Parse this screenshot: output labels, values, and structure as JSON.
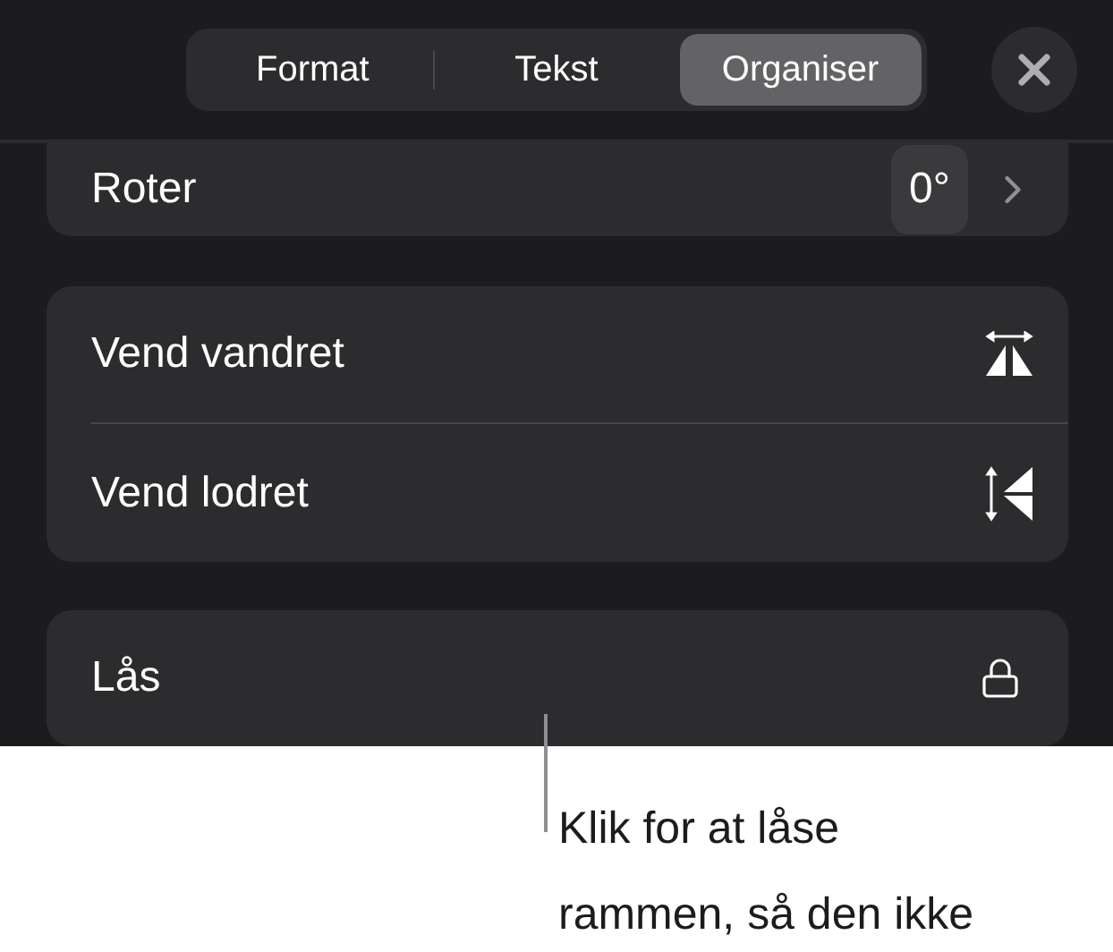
{
  "tabs": [
    {
      "label": "Format",
      "selected": false
    },
    {
      "label": "Tekst",
      "selected": false
    },
    {
      "label": "Organiser",
      "selected": true
    }
  ],
  "rotate": {
    "label": "Roter",
    "value": "0°"
  },
  "flip_rows": [
    {
      "label": "Vend vandret",
      "kind": "horizontal"
    },
    {
      "label": "Vend lodret",
      "kind": "vertical"
    }
  ],
  "lock": {
    "label": "Lås"
  },
  "callout": "Klik for at låse rammen, så den ikke"
}
